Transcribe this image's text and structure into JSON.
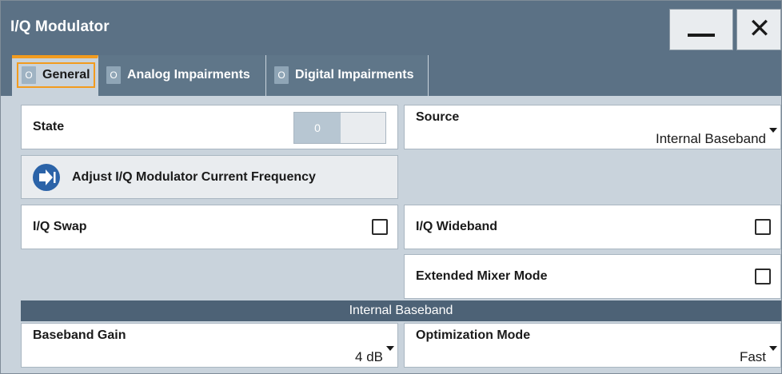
{
  "window": {
    "title": "I/Q Modulator",
    "minimize_icon": "minimize-icon",
    "close_icon": "close-icon",
    "close_glyph": "✕"
  },
  "tabs": [
    {
      "label": "General",
      "indicator": "O",
      "active": true
    },
    {
      "label": "Analog Impairments",
      "indicator": "O",
      "active": false
    },
    {
      "label": "Digital Impairments",
      "indicator": "O",
      "active": false
    }
  ],
  "state": {
    "label": "State",
    "toggle_value": "0"
  },
  "source": {
    "label": "Source",
    "value": "Internal Baseband"
  },
  "adjust_button": {
    "label": "Adjust I/Q Modulator Current Frequency",
    "icon": "arrow-right-icon"
  },
  "iq_swap": {
    "label": "I/Q Swap",
    "checked": false
  },
  "iq_wideband": {
    "label": "I/Q Wideband",
    "checked": false
  },
  "extended_mixer": {
    "label": "Extended Mixer Mode",
    "checked": false
  },
  "section": {
    "title": "Internal Baseband"
  },
  "baseband_gain": {
    "label": "Baseband Gain",
    "value": "4 dB"
  },
  "optimization_mode": {
    "label": "Optimization Mode",
    "value": "Fast"
  },
  "colors": {
    "titlebar": "#5b7185",
    "accent_orange": "#f29b1e",
    "action_icon": "#2b63a8",
    "section_header": "#4d6276",
    "background": "#c9d3dc"
  }
}
